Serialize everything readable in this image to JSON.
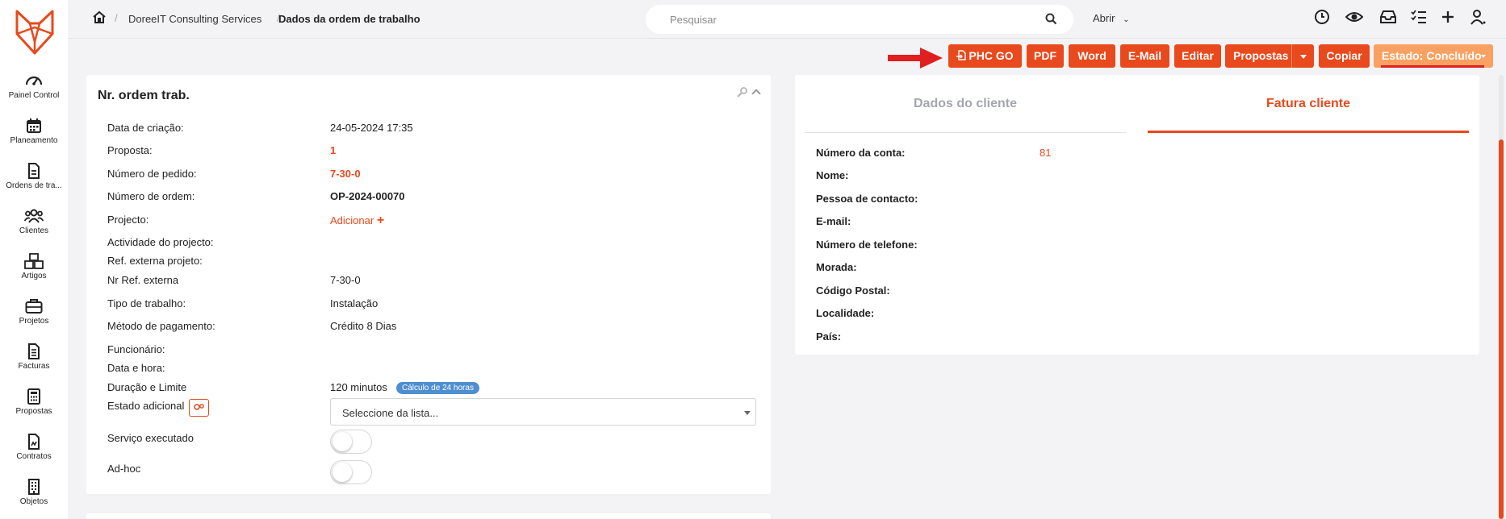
{
  "sidebar": {
    "items": [
      {
        "label": "Painel Control",
        "icon": "dashboard-icon"
      },
      {
        "label": "Planeamento",
        "icon": "calendar-icon"
      },
      {
        "label": "Ordens de tra...",
        "icon": "document-icon"
      },
      {
        "label": "Clientes",
        "icon": "users-icon"
      },
      {
        "label": "Artigos",
        "icon": "boxes-icon"
      },
      {
        "label": "Projetos",
        "icon": "briefcase-icon"
      },
      {
        "label": "Facturas",
        "icon": "invoice-icon"
      },
      {
        "label": "Propostas",
        "icon": "calculator-icon"
      },
      {
        "label": "Contratos",
        "icon": "contract-icon"
      },
      {
        "label": "Objetos",
        "icon": "building-icon"
      }
    ]
  },
  "header": {
    "breadcrumb": [
      "DoreeIT Consulting Services",
      "Dados da ordem de trabalho"
    ],
    "search_placeholder": "Pesquisar",
    "open_menu": "Abrir"
  },
  "actions": {
    "phc": "PHC GO",
    "pdf": "PDF",
    "word": "Word",
    "email": "E-Mail",
    "edit": "Editar",
    "proposals": "Propostas",
    "copy": "Copiar",
    "state": "Estado: Concluído"
  },
  "order": {
    "title": "Nr. ordem trab.",
    "rows": [
      {
        "label": "Data de criação:",
        "value": "24-05-2024 17:35"
      },
      {
        "label": "Proposta:",
        "value": "1"
      },
      {
        "label": "Número de pedido:",
        "value": "7-30-0"
      },
      {
        "label": "Número de ordem:",
        "value": "OP-2024-00070"
      },
      {
        "label": "Projecto:",
        "value": "Adicionar"
      },
      {
        "label": "Actividade do projecto:",
        "value": ""
      },
      {
        "label": "Ref. externa projeto:",
        "value": ""
      },
      {
        "label": "Nr Ref. externa",
        "value": "7-30-0"
      },
      {
        "label": "Tipo de trabalho:",
        "value": "Instalação"
      },
      {
        "label": "Método de pagamento:",
        "value": "Crédito 8 Dias"
      },
      {
        "label": "Funcionário:",
        "value": ""
      },
      {
        "label": "Data e hora:",
        "value": ""
      },
      {
        "label": "Duração e Limite",
        "value": "120 minutos"
      },
      {
        "label": "Estado adicional",
        "value": ""
      },
      {
        "label": "Serviço executado",
        "value": ""
      },
      {
        "label": "Ad-hoc",
        "value": ""
      }
    ],
    "duration_badge": "Cálculo de 24 horas",
    "select_placeholder": "Seleccione da lista..."
  },
  "client": {
    "tabs": [
      "Dados do cliente",
      "Fatura cliente"
    ],
    "active_tab": 1,
    "fields": [
      {
        "label": "Número da conta:",
        "value": "81"
      },
      {
        "label": "Nome:",
        "value": ""
      },
      {
        "label": "Pessoa de contacto:",
        "value": ""
      },
      {
        "label": "E-mail:",
        "value": ""
      },
      {
        "label": "Número de telefone:",
        "value": ""
      },
      {
        "label": "Morada:",
        "value": ""
      },
      {
        "label": "Código Postal:",
        "value": ""
      },
      {
        "label": "Localidade:",
        "value": ""
      },
      {
        "label": "País:",
        "value": ""
      }
    ]
  },
  "colors": {
    "accent": "#e8491d",
    "state_button": "#f9a162",
    "badge": "#4e8ed1",
    "arrow": "#e02020"
  }
}
